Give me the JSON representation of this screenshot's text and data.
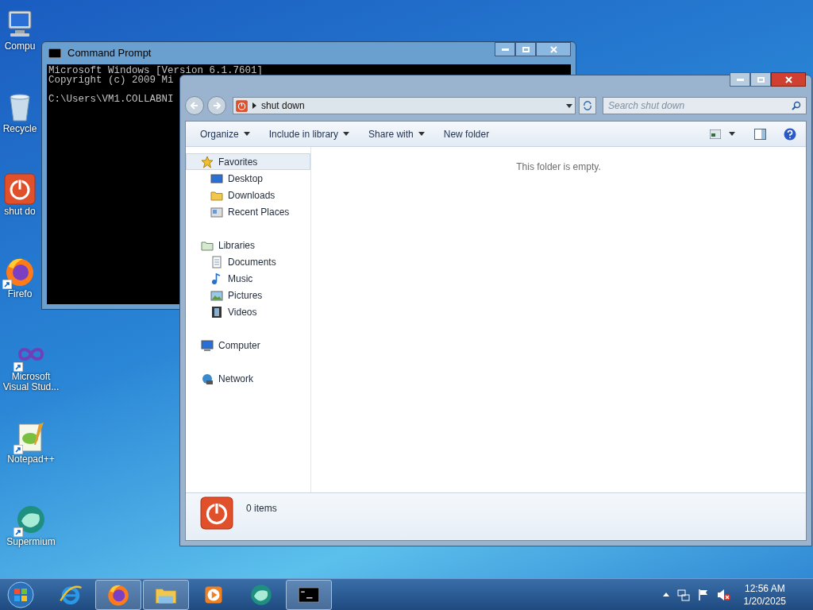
{
  "desktop_icons": [
    {
      "kind": "computer",
      "label": "Compu"
    },
    {
      "kind": "recycle",
      "label": "Recycle"
    },
    {
      "kind": "power",
      "label": "shut do"
    },
    {
      "kind": "firefox",
      "label": "Firefo"
    },
    {
      "kind": "vs",
      "label": "Microsoft Visual Stud..."
    },
    {
      "kind": "notepad",
      "label": "Notepad++"
    },
    {
      "kind": "supermium",
      "label": "Supermium"
    }
  ],
  "cmd_window": {
    "title": "Command Prompt",
    "lines": [
      {
        "text": "Microsoft Windows [Version 6.1.7601]",
        "blank_before": false
      },
      {
        "text": "Copyright (c) 2009 Mi",
        "blank_before": false
      },
      {
        "text": "C:\\Users\\VM1.COLLABNI",
        "blank_before": true
      }
    ]
  },
  "explorer": {
    "path": "shut down",
    "search": {
      "placeholder": "Search shut down"
    },
    "toolbar": [
      "Organize",
      "Include in library",
      "Share with",
      "New folder"
    ],
    "nav": [
      {
        "kind": "star",
        "label": "Favorites",
        "selected": true,
        "children": [
          {
            "kind": "desktop",
            "label": "Desktop",
            "selected": false
          },
          {
            "kind": "folder",
            "label": "Downloads",
            "selected": false
          },
          {
            "kind": "places",
            "label": "Recent Places",
            "selected": false
          }
        ]
      },
      {
        "kind": "library",
        "label": "Libraries",
        "selected": false,
        "children": [
          {
            "kind": "doc",
            "label": "Documents",
            "selected": false
          },
          {
            "kind": "music",
            "label": "Music",
            "selected": false
          },
          {
            "kind": "picture",
            "label": "Pictures",
            "selected": false
          },
          {
            "kind": "video",
            "label": "Videos",
            "selected": false
          }
        ]
      },
      {
        "kind": "computer",
        "label": "Computer",
        "selected": false
      },
      {
        "kind": "network",
        "label": "Network",
        "selected": false
      }
    ],
    "empty_message": "This folder is empty.",
    "status": "0 items"
  },
  "taskbar": {
    "items": [
      {
        "kind": "ie",
        "running": false
      },
      {
        "kind": "firefox",
        "running": true
      },
      {
        "kind": "explorer",
        "running": true
      },
      {
        "kind": "media",
        "running": false
      },
      {
        "kind": "supermium",
        "running": false
      },
      {
        "kind": "cmd",
        "running": true
      }
    ],
    "time": "12:56 AM",
    "date": "1/20/2025"
  }
}
